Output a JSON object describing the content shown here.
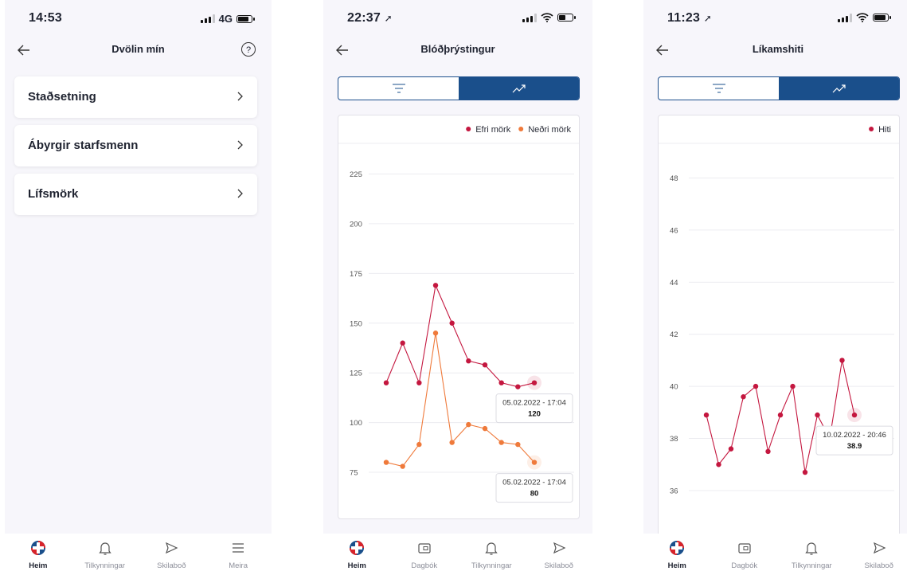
{
  "colors": {
    "primary": "#1a4f8b",
    "series_upper": "#c4173f",
    "series_lower": "#ef7a3b"
  },
  "screen1": {
    "status": {
      "time": "14:53",
      "network": "4G"
    },
    "header": {
      "title": "Dvölin mín"
    },
    "items": [
      {
        "label": "Staðsetning"
      },
      {
        "label": "Ábyrgir starfsmenn"
      },
      {
        "label": "Lífsmörk"
      }
    ],
    "tabs": [
      {
        "label": "Heim",
        "icon": "logo-icon"
      },
      {
        "label": "Tilkynningar",
        "icon": "bell-icon"
      },
      {
        "label": "Skilaboð",
        "icon": "send-icon"
      },
      {
        "label": "Meira",
        "icon": "menu-icon"
      }
    ]
  },
  "screen2": {
    "status": {
      "time": "22:37"
    },
    "header": {
      "title": "Blóðþrýstingur"
    },
    "tabs": [
      {
        "label": "Heim",
        "icon": "logo-icon"
      },
      {
        "label": "Dagbók",
        "icon": "wallet-icon"
      },
      {
        "label": "Tilkynningar",
        "icon": "bell-icon"
      },
      {
        "label": "Skilaboð",
        "icon": "send-icon"
      }
    ]
  },
  "screen3": {
    "status": {
      "time": "11:23"
    },
    "header": {
      "title": "Líkamshiti"
    },
    "tabs": [
      {
        "label": "Heim",
        "icon": "logo-icon"
      },
      {
        "label": "Dagbók",
        "icon": "wallet-icon"
      },
      {
        "label": "Tilkynningar",
        "icon": "bell-icon"
      },
      {
        "label": "Skilaboð",
        "icon": "send-icon"
      }
    ]
  },
  "chart_data": [
    {
      "type": "line",
      "legend": "top-right",
      "grid": true,
      "ylim": [
        55,
        240
      ],
      "yticks": [
        75,
        100,
        125,
        150,
        175,
        200,
        225
      ],
      "series": [
        {
          "name": "Efri mörk",
          "color": "#c4173f",
          "values": [
            120,
            140,
            120,
            169,
            150,
            131,
            129,
            120,
            118,
            120
          ]
        },
        {
          "name": "Neðri mörk",
          "color": "#ef7a3b",
          "values": [
            80,
            78,
            89,
            145,
            90,
            99,
            97,
            90,
            89,
            80
          ]
        }
      ],
      "tooltips": [
        {
          "series": 0,
          "date": "05.02.2022 - 17:04",
          "value": "120"
        },
        {
          "series": 1,
          "date": "05.02.2022 - 17:04",
          "value": "80"
        }
      ]
    },
    {
      "type": "line",
      "legend": "top-right",
      "grid": true,
      "ylim": [
        34.5,
        49.3
      ],
      "yticks": [
        36,
        38,
        40,
        42,
        44,
        46,
        48
      ],
      "series": [
        {
          "name": "Hiti",
          "color": "#c4173f",
          "values": [
            38.9,
            37.0,
            37.6,
            39.6,
            40.0,
            37.5,
            38.9,
            40.0,
            36.7,
            38.9,
            38.0,
            41.0,
            38.9
          ]
        }
      ],
      "tooltips": [
        {
          "series": 0,
          "date": "10.02.2022 - 20:46",
          "value": "38.9"
        }
      ]
    }
  ]
}
